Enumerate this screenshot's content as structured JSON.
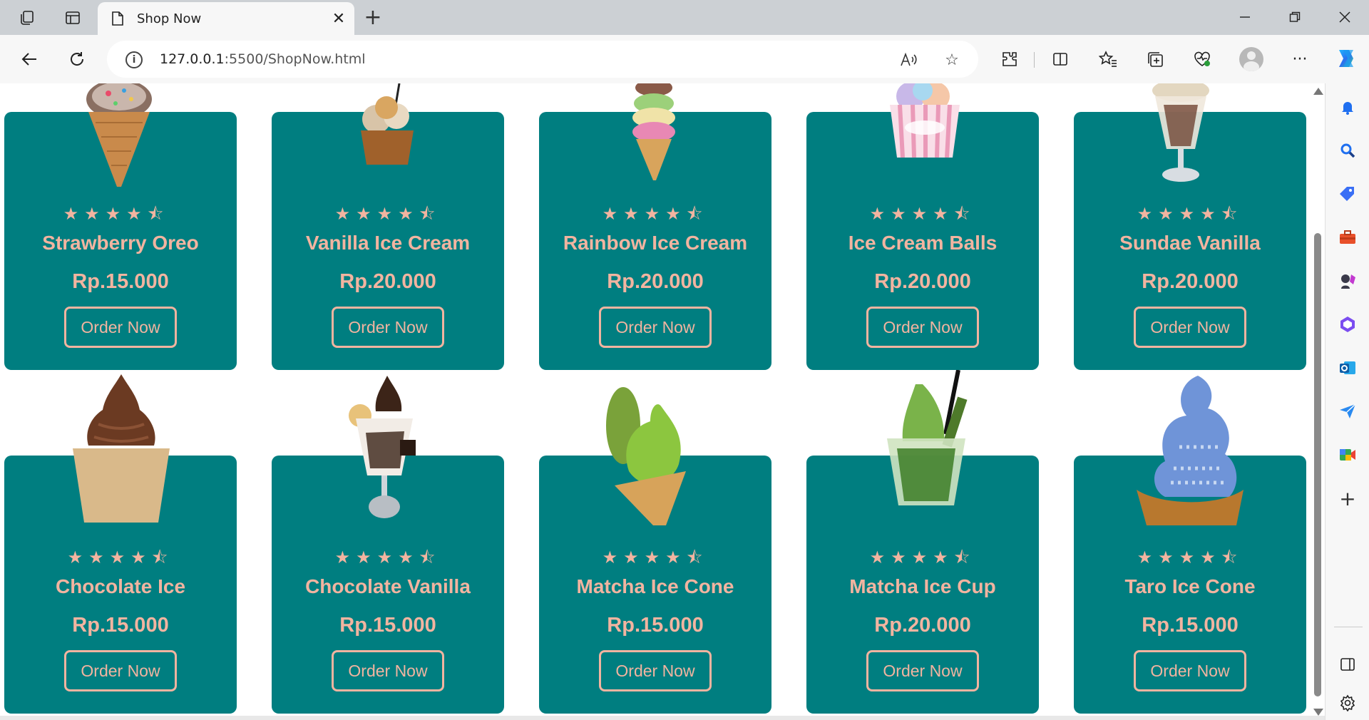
{
  "browser": {
    "tab_title": "Shop Now",
    "url_host": "127.0.0.1",
    "url_rest": ":5500/ShopNow.html"
  },
  "theme": {
    "card_bg": "#007e80",
    "accent": "#f2b4a0"
  },
  "products": [
    {
      "name": "Strawberry Oreo",
      "price": "Rp.15.000",
      "stars": "★★★★⯪",
      "rating": 4.5,
      "button": "Order Now"
    },
    {
      "name": "Vanilla Ice Cream",
      "price": "Rp.20.000",
      "stars": "★★★★⯪",
      "rating": 4.5,
      "button": "Order Now"
    },
    {
      "name": "Rainbow Ice Cream",
      "price": "Rp.20.000",
      "stars": "★★★★⯪",
      "rating": 4.5,
      "button": "Order Now"
    },
    {
      "name": "Ice Cream Balls",
      "price": "Rp.20.000",
      "stars": "★★★★⯪",
      "rating": 4.5,
      "button": "Order Now"
    },
    {
      "name": "Sundae Vanilla",
      "price": "Rp.20.000",
      "stars": "★★★★⯪",
      "rating": 4.5,
      "button": "Order Now"
    },
    {
      "name": "Chocolate Ice",
      "price": "Rp.15.000",
      "stars": "★★★★⯪",
      "rating": 4.5,
      "button": "Order Now"
    },
    {
      "name": "Chocolate Vanilla",
      "price": "Rp.15.000",
      "stars": "★★★★⯪",
      "rating": 4.5,
      "button": "Order Now"
    },
    {
      "name": "Matcha Ice Cone",
      "price": "Rp.15.000",
      "stars": "★★★★⯪",
      "rating": 4.5,
      "button": "Order Now"
    },
    {
      "name": "Matcha Ice Cup",
      "price": "Rp.20.000",
      "stars": "★★★★⯪",
      "rating": 4.5,
      "button": "Order Now"
    },
    {
      "name": "Taro Ice Cone",
      "price": "Rp.15.000",
      "stars": "★★★★⯪",
      "rating": 4.5,
      "button": "Order Now"
    }
  ]
}
